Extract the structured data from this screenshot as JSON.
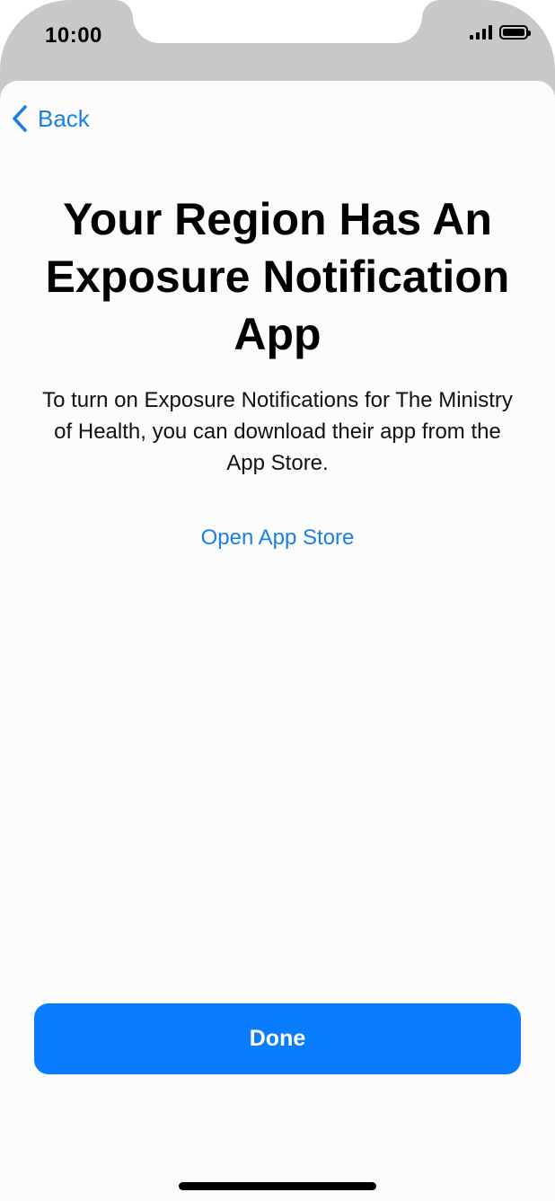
{
  "status_bar": {
    "time": "10:00",
    "signal_icon": "cellular-signal-icon",
    "battery_icon": "battery-icon"
  },
  "nav": {
    "back_label": "Back",
    "back_icon": "chevron-left-icon"
  },
  "content": {
    "title": "Your Region Has An Exposure Notification App",
    "description": "To turn on Exposure Notifications for The Ministry of Health, you can download their app from the App Store.",
    "link_label": "Open App Store"
  },
  "footer": {
    "done_label": "Done"
  },
  "colors": {
    "accent": "#0a7dff",
    "link": "#1a7fe6",
    "bezel": "#c8c8c8"
  }
}
